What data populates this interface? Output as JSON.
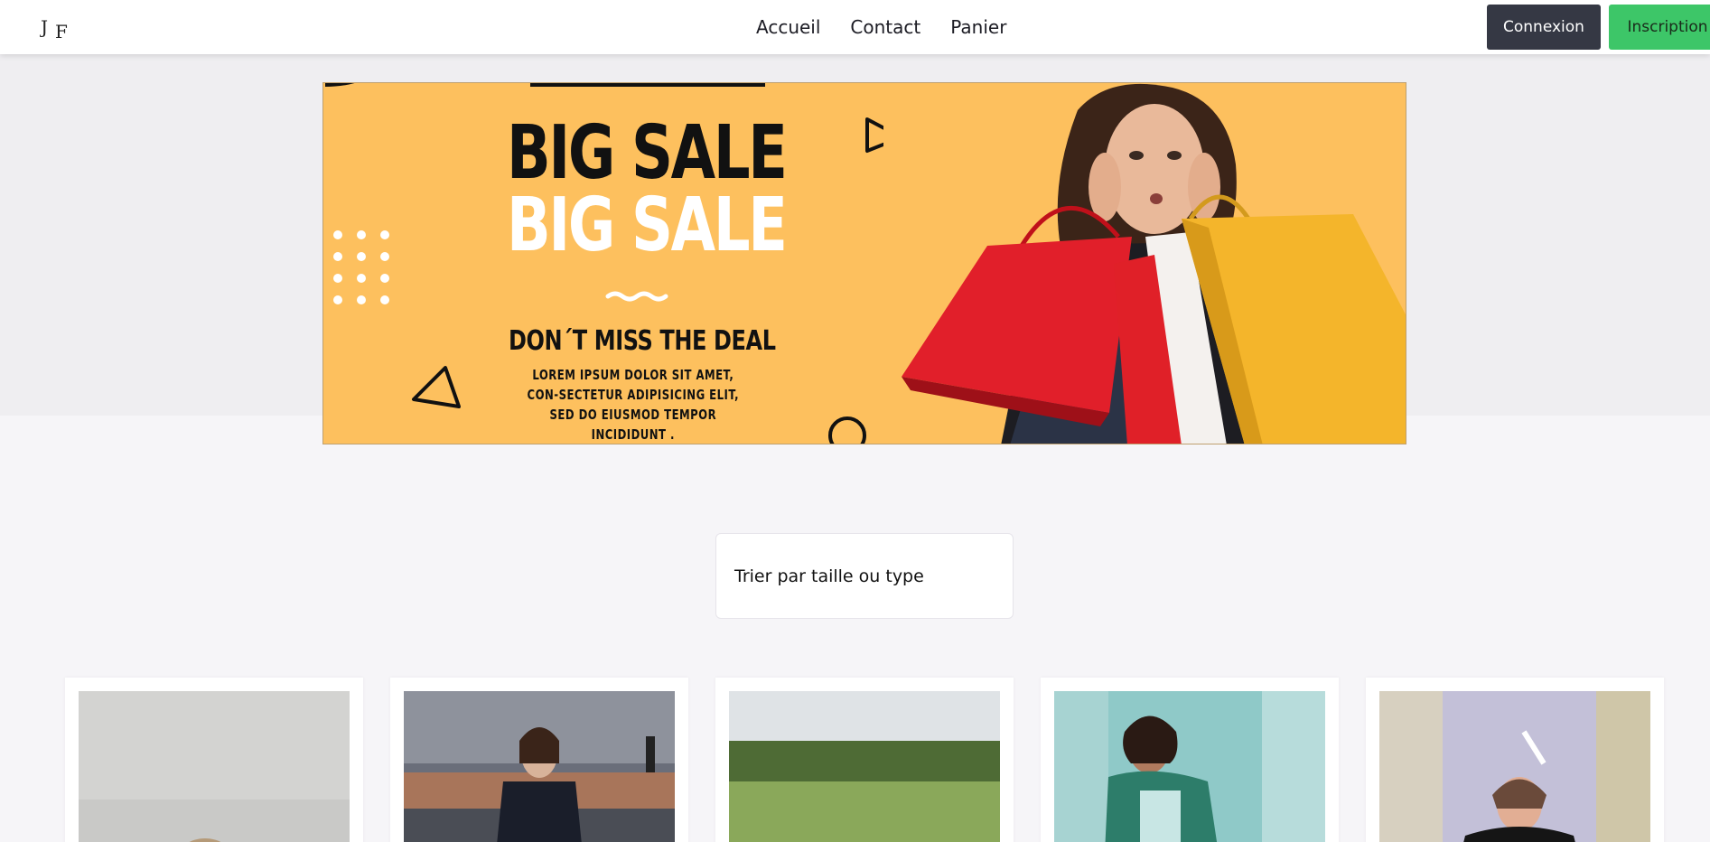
{
  "header": {
    "logo_text": "JF",
    "nav": [
      {
        "label": "Accueil"
      },
      {
        "label": "Contact"
      },
      {
        "label": "Panier"
      }
    ],
    "login_label": "Connexion",
    "signup_label": "Inscription"
  },
  "banner": {
    "headline_1": "BIG SALE",
    "headline_2": "BIG SALE",
    "deal_title": "DON´T MISS THE DEAL",
    "deal_text": "LOREM IPSUM DOLOR SIT AMET, CON-SECTETUR ADIPISICING ELIT, SED DO EIUSMOD TEMPOR INCIDIDUNT ."
  },
  "sort": {
    "label": "Trier par taille ou type"
  },
  "colors": {
    "accent_login": "#353844",
    "accent_signup": "#3dc668",
    "banner_bg": "#fdc05e"
  }
}
